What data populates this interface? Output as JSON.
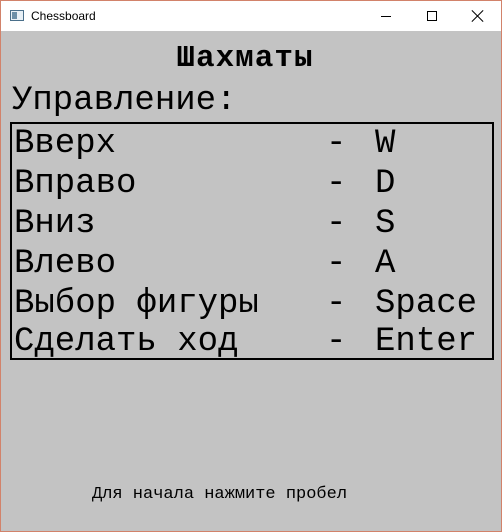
{
  "window": {
    "title": "Chessboard",
    "icon": "app-window-icon"
  },
  "heading": "Шахматы",
  "controls_label": "Управление:",
  "controls": [
    {
      "action": "Вверх",
      "dash": "-",
      "key": "W"
    },
    {
      "action": "Вправо",
      "dash": "-",
      "key": "D"
    },
    {
      "action": "Вниз",
      "dash": "-",
      "key": "S"
    },
    {
      "action": "Влево",
      "dash": "-",
      "key": "A"
    },
    {
      "action": "Выбор фигуры",
      "dash": "-",
      "key": "Space"
    },
    {
      "action": "Сделать ход",
      "dash": "-",
      "key": "Enter"
    }
  ],
  "footer": "Для начала нажмите пробел",
  "colors": {
    "background": "#c3c3c3",
    "titlebar": "#ffffff",
    "window_border": "#d2826a",
    "text": "#000000"
  }
}
